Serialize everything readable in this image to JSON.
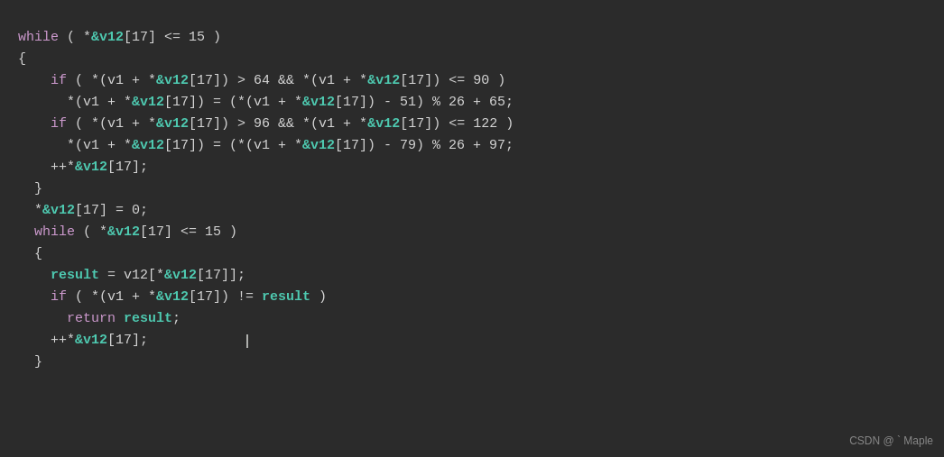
{
  "bg_color": "#2b2b2b",
  "watermark": "CSDN @ ` Maple",
  "lines": [
    {
      "id": "line1",
      "parts": [
        {
          "text": "while",
          "class": "kw"
        },
        {
          "text": " ( *",
          "class": "plain"
        },
        {
          "text": "&v12",
          "class": "bold-cyan"
        },
        {
          "text": "[17] <= 15 )",
          "class": "plain"
        }
      ]
    },
    {
      "id": "line2",
      "parts": [
        {
          "text": "{",
          "class": "plain"
        }
      ]
    },
    {
      "id": "line3",
      "parts": [
        {
          "text": "    ",
          "class": "plain"
        },
        {
          "text": "if",
          "class": "kw"
        },
        {
          "text": " ( *(v1 + *",
          "class": "plain"
        },
        {
          "text": "&v12",
          "class": "bold-cyan"
        },
        {
          "text": "[17]) > 64 && *(v1 + *",
          "class": "plain"
        },
        {
          "text": "&v12",
          "class": "bold-cyan"
        },
        {
          "text": "[17]) <= 90 )",
          "class": "plain"
        }
      ]
    },
    {
      "id": "line4",
      "parts": [
        {
          "text": "      *(v1 + *",
          "class": "plain"
        },
        {
          "text": "&v12",
          "class": "bold-cyan"
        },
        {
          "text": "[17]) = (*(v1 + *",
          "class": "plain"
        },
        {
          "text": "&v12",
          "class": "bold-cyan"
        },
        {
          "text": "[17]) - 51) % 26 + 65;",
          "class": "plain"
        }
      ]
    },
    {
      "id": "line5",
      "parts": [
        {
          "text": "    ",
          "class": "plain"
        },
        {
          "text": "if",
          "class": "kw"
        },
        {
          "text": " ( *(v1 + *",
          "class": "plain"
        },
        {
          "text": "&v12",
          "class": "bold-cyan"
        },
        {
          "text": "[17]) > 96 && *(v1 + *",
          "class": "plain"
        },
        {
          "text": "&v12",
          "class": "bold-cyan"
        },
        {
          "text": "[17]) <= 122 )",
          "class": "plain"
        }
      ]
    },
    {
      "id": "line6",
      "parts": [
        {
          "text": "      *(v1 + *",
          "class": "plain"
        },
        {
          "text": "&v12",
          "class": "bold-cyan"
        },
        {
          "text": "[17]) = (*(v1 + *",
          "class": "plain"
        },
        {
          "text": "&v12",
          "class": "bold-cyan"
        },
        {
          "text": "[17]) - 79) % 26 + 97;",
          "class": "plain"
        }
      ]
    },
    {
      "id": "line7",
      "parts": [
        {
          "text": "    ++*",
          "class": "plain"
        },
        {
          "text": "&v12",
          "class": "bold-cyan"
        },
        {
          "text": "[17];",
          "class": "plain"
        }
      ]
    },
    {
      "id": "line8",
      "parts": [
        {
          "text": "  }",
          "class": "plain"
        }
      ]
    },
    {
      "id": "line9",
      "parts": [
        {
          "text": "  *",
          "class": "plain"
        },
        {
          "text": "&v12",
          "class": "bold-cyan"
        },
        {
          "text": "[17] = 0;",
          "class": "plain"
        }
      ]
    },
    {
      "id": "line10",
      "parts": [
        {
          "text": "  ",
          "class": "plain"
        },
        {
          "text": "while",
          "class": "kw"
        },
        {
          "text": " ( *",
          "class": "plain"
        },
        {
          "text": "&v12",
          "class": "bold-cyan"
        },
        {
          "text": "[17] <= 15 )",
          "class": "plain"
        }
      ]
    },
    {
      "id": "line11",
      "parts": [
        {
          "text": "  {",
          "class": "plain"
        }
      ]
    },
    {
      "id": "line12",
      "parts": [
        {
          "text": "    ",
          "class": "plain"
        },
        {
          "text": "result",
          "class": "bold-cyan"
        },
        {
          "text": " = v12[*",
          "class": "plain"
        },
        {
          "text": "&v12",
          "class": "bold-cyan"
        },
        {
          "text": "[17]];",
          "class": "plain"
        }
      ]
    },
    {
      "id": "line13",
      "parts": [
        {
          "text": "    ",
          "class": "plain"
        },
        {
          "text": "if",
          "class": "kw"
        },
        {
          "text": " ( *(v1 + *",
          "class": "plain"
        },
        {
          "text": "&v12",
          "class": "bold-cyan"
        },
        {
          "text": "[17]) != ",
          "class": "plain"
        },
        {
          "text": "result",
          "class": "bold-cyan"
        },
        {
          "text": " )",
          "class": "plain"
        }
      ]
    },
    {
      "id": "line14",
      "parts": [
        {
          "text": "      ",
          "class": "plain"
        },
        {
          "text": "return",
          "class": "kw"
        },
        {
          "text": " ",
          "class": "plain"
        },
        {
          "text": "result",
          "class": "bold-cyan"
        },
        {
          "text": ";",
          "class": "plain"
        }
      ]
    },
    {
      "id": "line15",
      "parts": [
        {
          "text": "    ++*",
          "class": "plain"
        },
        {
          "text": "&v12",
          "class": "bold-cyan"
        },
        {
          "text": "[17];",
          "class": "plain"
        }
      ],
      "cursor": true
    },
    {
      "id": "line16",
      "parts": [
        {
          "text": "  }",
          "class": "plain"
        }
      ]
    }
  ]
}
